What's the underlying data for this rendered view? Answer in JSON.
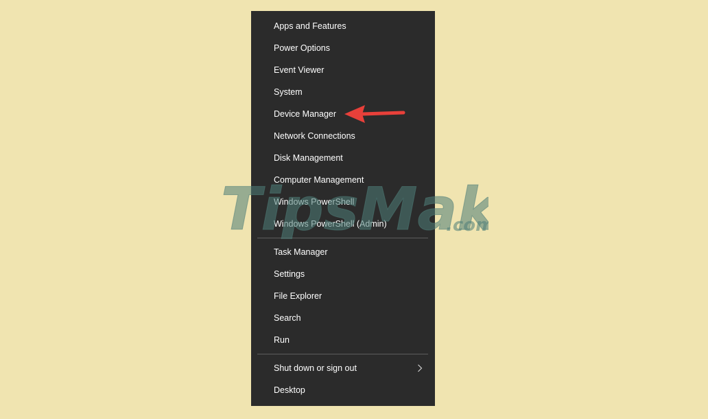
{
  "menu": {
    "group1": [
      {
        "id": "apps-and-features",
        "label": "Apps and Features"
      },
      {
        "id": "power-options",
        "label": "Power Options"
      },
      {
        "id": "event-viewer",
        "label": "Event Viewer"
      },
      {
        "id": "system",
        "label": "System"
      },
      {
        "id": "device-manager",
        "label": "Device Manager"
      },
      {
        "id": "network-connections",
        "label": "Network Connections"
      },
      {
        "id": "disk-management",
        "label": "Disk Management"
      },
      {
        "id": "computer-management",
        "label": "Computer Management"
      },
      {
        "id": "windows-powershell",
        "label": "Windows PowerShell"
      },
      {
        "id": "windows-powershell-admin",
        "label": "Windows PowerShell (Admin)"
      }
    ],
    "group2": [
      {
        "id": "task-manager",
        "label": "Task Manager"
      },
      {
        "id": "settings",
        "label": "Settings"
      },
      {
        "id": "file-explorer",
        "label": "File Explorer"
      },
      {
        "id": "search",
        "label": "Search"
      },
      {
        "id": "run",
        "label": "Run"
      }
    ],
    "group3": [
      {
        "id": "shut-down",
        "label": "Shut down or sign out",
        "submenu": true,
        "icon": "chevron-right-icon"
      },
      {
        "id": "desktop",
        "label": "Desktop"
      }
    ]
  },
  "annotation": {
    "arrow_color": "#e8403a",
    "arrow_target": "device-manager",
    "icon": "red-arrow-icon"
  },
  "watermark": {
    "text_main": "TipsMake",
    "text_suffix": ".com",
    "color": "#4f7d78"
  },
  "colors": {
    "background": "#f0e4b0",
    "menu_bg": "#2b2b2b",
    "menu_text": "#ffffff",
    "separator": "#5e5e5e"
  }
}
